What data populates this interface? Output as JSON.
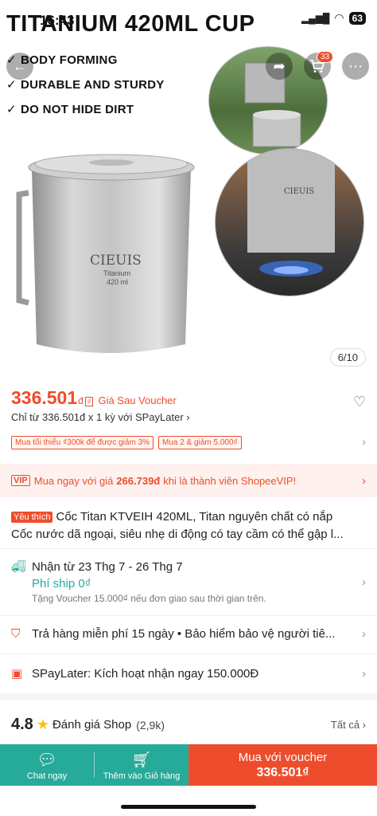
{
  "status": {
    "time": "16:43",
    "battery": "63"
  },
  "hero": {
    "title": "TITANIUM 420ML CUP",
    "features": [
      "BODY FORMING",
      "DURABLE AND STURDY",
      "DO NOT HIDE DIRT"
    ],
    "cup_brand": "CIEUIS",
    "cup_sub1": "Titanium",
    "cup_sub2": "420 ml",
    "circle_brand": "CIEUIS",
    "image_counter": "6/10",
    "cart_badge": "33"
  },
  "price": {
    "amount": "336.501",
    "unit": "đ",
    "note": "Giá Sau Voucher",
    "spaylater": "Chỉ từ 336.501đ x 1 kỳ với SPayLater ›"
  },
  "chips": [
    "Mua tối thiểu ₫300k để được giảm 3%",
    "Mua 2 & giảm 5.000₫"
  ],
  "vip": {
    "tag": "VIP",
    "pre": "Mua ngay với giá",
    "price": "266.739đ",
    "post": "khi là thành viên ShopeeVIP!"
  },
  "product": {
    "fav_tag": "Yêu thích",
    "title_line1": "Cốc Titan KTVEIH 420ML, Titan nguyên chất có nắp",
    "title_line2": "Cốc nước dã ngoại, siêu nhẹ di động có tay cầm có thể gập l..."
  },
  "shipping": {
    "date": "Nhận từ 23 Thg 7 - 26 Thg 7",
    "free": "Phí ship 0₫",
    "note": "Tặng Voucher 15.000₫ nếu đơn giao sau thời gian trên."
  },
  "returns": "Trả hàng miễn phí 15 ngày  •  Bảo hiểm bảo vệ người tiê...",
  "spaylater_row": "SPayLater: Kích hoạt nhận ngay 150.000Đ",
  "rating": {
    "score": "4.8",
    "label": "Đánh giá Shop",
    "count": "(2,9k)",
    "see_all": "Tất cả"
  },
  "bottom_bar": {
    "chat": "Chat ngay",
    "add_cart": "Thêm vào Giỏ hàng",
    "buy_line1": "Mua với voucher",
    "buy_line2": "336.501₫"
  },
  "colors": {
    "accent": "#ee4d2d",
    "green": "#26aa99"
  }
}
